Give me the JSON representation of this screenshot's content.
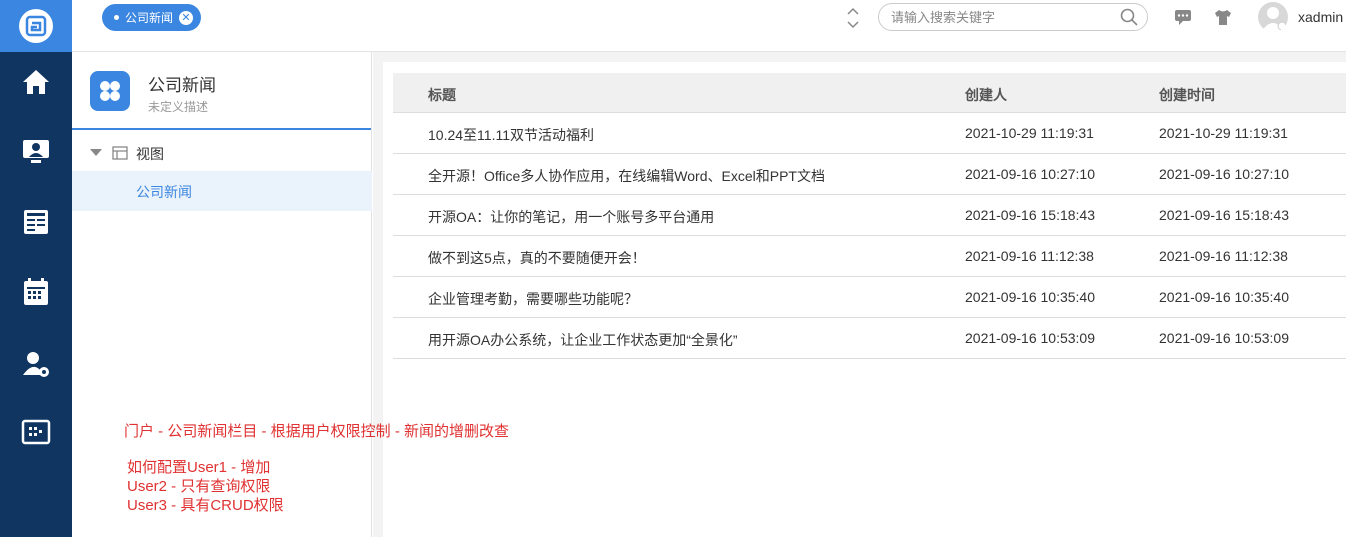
{
  "nav": {
    "items": [
      {
        "name": "home",
        "icon": "home-icon"
      },
      {
        "name": "monitor-user",
        "icon": "monitor-user-icon"
      },
      {
        "name": "form",
        "icon": "form-icon"
      },
      {
        "name": "calendar",
        "icon": "calendar-icon"
      },
      {
        "name": "user-settings",
        "icon": "user-settings-icon"
      },
      {
        "name": "board",
        "icon": "board-icon"
      }
    ]
  },
  "header": {
    "tab_label": "公司新闻",
    "search_placeholder": "请输入搜索关键字",
    "username": "xadmin"
  },
  "side": {
    "title": "公司新闻",
    "description": "未定义描述",
    "tree_node": "视图",
    "tree_leaf": "公司新闻"
  },
  "table": {
    "headers": [
      "标题",
      "创建人",
      "创建时间"
    ],
    "rows": [
      [
        "10.24至11.11双节活动福利",
        "2021-10-29 11:19:31",
        "2021-10-29 11:19:31"
      ],
      [
        "全开源！Office多人协作应用，在线编辑Word、Excel和PPT文档",
        "2021-09-16 10:27:10",
        "2021-09-16 10:27:10"
      ],
      [
        "开源OA：让你的笔记，用一个账号多平台通用",
        "2021-09-16 15:18:43",
        "2021-09-16 15:18:43"
      ],
      [
        "做不到这5点，真的不要随便开会！",
        "2021-09-16 11:12:38",
        "2021-09-16 11:12:38"
      ],
      [
        "企业管理考勤，需要哪些功能呢？",
        "2021-09-16 10:35:40",
        "2021-09-16 10:35:40"
      ],
      [
        "用开源OA办公系统，让企业工作状态更加“全景化”",
        "2021-09-16 10:53:09",
        "2021-09-16 10:53:09"
      ]
    ]
  },
  "notes": {
    "line1": "门户 - 公司新闻栏目 - 根据用户权限控制 - 新闻的增删改查",
    "line2": "如何配置User1 - 增加",
    "line3": "User2 - 只有查询权限",
    "line4": "User3 - 具有CRUD权限"
  },
  "colors": {
    "nav_bg": "#0f3560",
    "accent": "#3a86e0",
    "annotation": "#e03232"
  }
}
